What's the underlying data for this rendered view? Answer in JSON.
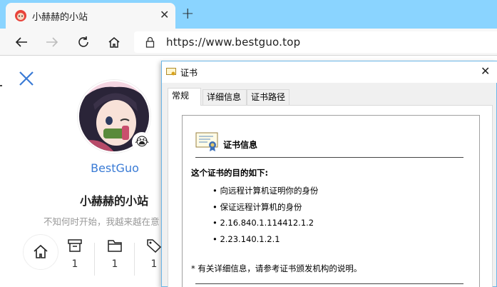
{
  "browser": {
    "tab_title": "小赫赫的小站",
    "url": "https://www.bestguo.top",
    "accent": "#8ad4ff"
  },
  "profile": {
    "emoji": "😭",
    "username": "BestGuo",
    "site_title": "小赫赫的小站",
    "tagline": "不知何时开始，我越来越在意",
    "stats": [
      {
        "icon": "archive-icon",
        "count": "1"
      },
      {
        "icon": "folder-icon",
        "count": "1"
      },
      {
        "icon": "tag-icon",
        "count": "1"
      }
    ]
  },
  "dialog": {
    "title": "证书",
    "tabs": [
      "常规",
      "详细信息",
      "证书路径"
    ],
    "heading": "证书信息",
    "purpose_label": "这个证书的目的如下:",
    "purposes": [
      "• 向远程计算机证明你的身份",
      "• 保证远程计算机的身份",
      "• 2.16.840.1.114412.1.2",
      "• 2.23.140.1.2.1"
    ],
    "note": "* 有关详细信息，请参考证书颁发机构的说明。"
  }
}
